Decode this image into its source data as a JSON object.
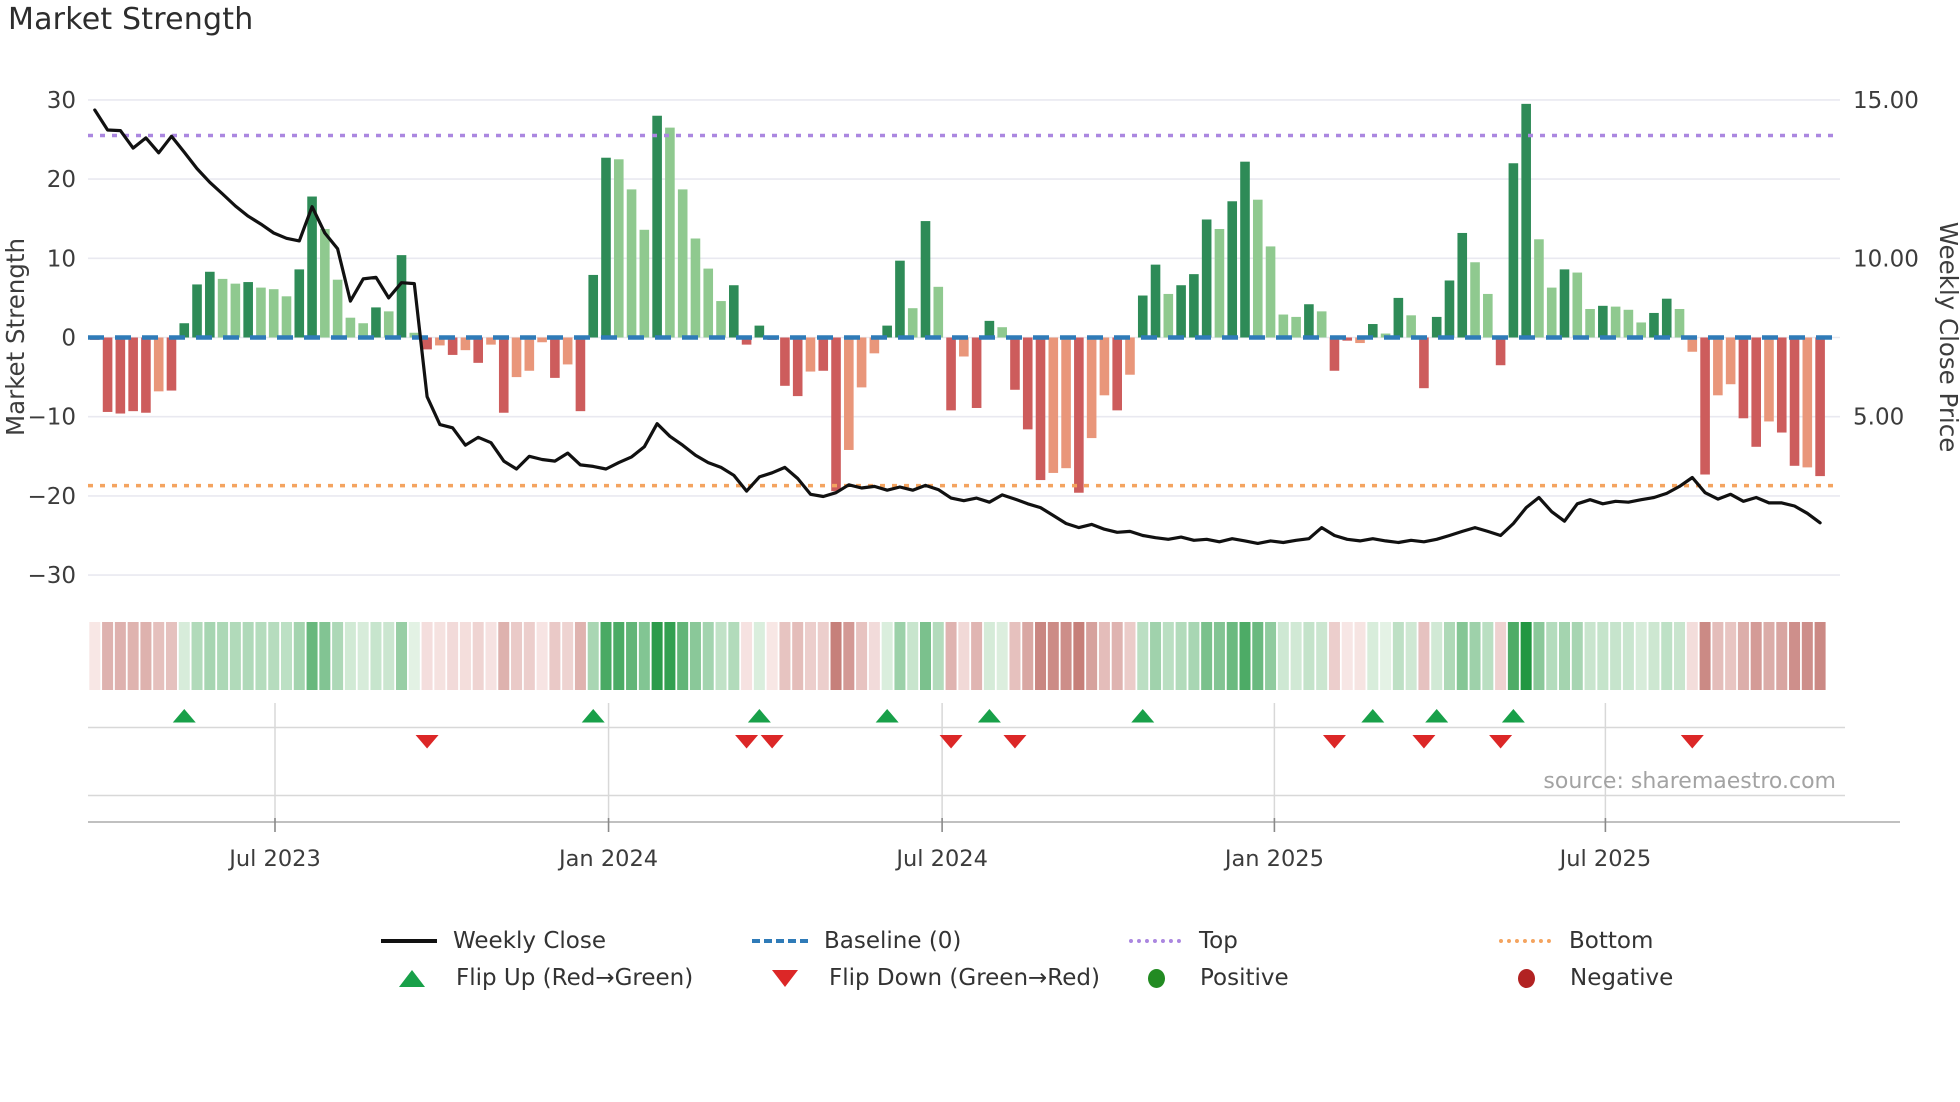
{
  "title": "Market Strength",
  "source_text": "source: sharemaestro.com",
  "axes": {
    "left_label": "Market Strength",
    "right_label": "Weekly Close Price",
    "left_ticks": [
      30,
      20,
      10,
      0,
      -10,
      -20,
      -30
    ],
    "right_ticks": [
      {
        "label": "15.00",
        "at_strength": 30
      },
      {
        "label": "10.00",
        "at_strength": 10
      },
      {
        "label": "5.00",
        "at_strength": -10
      }
    ],
    "x_ticks": [
      {
        "week": 14.1,
        "label": "Jul 2023"
      },
      {
        "week": 40.2,
        "label": "Jan 2024"
      },
      {
        "week": 66.3,
        "label": "Jul 2024"
      },
      {
        "week": 92.3,
        "label": "Jan 2025"
      },
      {
        "week": 118.2,
        "label": "Jul 2025"
      }
    ]
  },
  "legend": {
    "row1": [
      {
        "label": "Weekly Close"
      },
      {
        "label": "Baseline (0)"
      },
      {
        "label": "Top"
      },
      {
        "label": "Bottom"
      }
    ],
    "row2": [
      {
        "label": "Flip Up (Red→Green)"
      },
      {
        "label": "Flip Down (Green→Red)"
      },
      {
        "label": "Positive"
      },
      {
        "label": "Negative"
      }
    ]
  },
  "colors": {
    "bar_pos_strong": "#2e8b57",
    "bar_pos_light": "#8fc98f",
    "bar_neg_strong": "#cd5c5c",
    "bar_neg_light": "#e9967a",
    "line": "#111111",
    "baseline": "#2f7bb8",
    "top_line": "#ab87e0",
    "bottom_line": "#f4a460",
    "flip_up": "#18a049",
    "flip_down": "#dc2727",
    "positive_dot": "#228b22",
    "negative_dot": "#b22222",
    "grid": "#e9e9f0",
    "sub_grid": "#d8d8d8",
    "axis_line": "#c0c0c0",
    "tick_text": "#3c3c3c",
    "source_text": "#a3a3a3",
    "heat_pos_max": "#1f9640",
    "heat_pos_min": "#eaf5ea",
    "heat_neg_max": "#c0736d",
    "heat_neg_min": "#f9e9e8"
  },
  "chart_data": {
    "type": "bar",
    "title": "Market Strength",
    "weeks": 136,
    "ylim_left": [
      -32,
      31.5
    ],
    "grid": "horizontal",
    "legend_position": "bottom-center",
    "top_line_value": 25.5,
    "baseline_value": 0,
    "bottom_line_value": -18.7,
    "strength": {
      "name": "Market Strength",
      "values": [
        -0.3,
        -9.4,
        -9.6,
        -9.3,
        -9.5,
        -6.8,
        -6.7,
        1.8,
        6.7,
        8.3,
        7.4,
        6.8,
        7.0,
        6.3,
        6.1,
        5.2,
        8.6,
        17.8,
        13.7,
        7.3,
        2.5,
        1.8,
        3.8,
        3.3,
        10.4,
        0.6,
        -1.5,
        -1.0,
        -2.2,
        -1.6,
        -3.2,
        -0.9,
        -9.5,
        -5.0,
        -4.2,
        -0.6,
        -5.1,
        -3.4,
        -9.3,
        7.9,
        22.7,
        22.5,
        18.7,
        13.6,
        28.0,
        26.5,
        18.7,
        12.5,
        8.7,
        4.6,
        6.6,
        -0.9,
        1.5,
        -0.3,
        -6.1,
        -7.4,
        -4.3,
        -4.2,
        -19.4,
        -14.2,
        -6.3,
        -2.0,
        1.5,
        9.7,
        3.7,
        14.7,
        6.4,
        -9.2,
        -2.4,
        -8.9,
        2.1,
        1.3,
        -6.6,
        -11.6,
        -18.0,
        -17.1,
        -16.5,
        -19.6,
        -12.7,
        -7.3,
        -9.2,
        -4.7,
        5.3,
        9.2,
        5.5,
        6.6,
        8.0,
        14.9,
        13.7,
        17.2,
        22.2,
        17.4,
        11.5,
        2.9,
        2.6,
        4.2,
        3.3,
        -4.2,
        -0.4,
        -0.7,
        1.7,
        0.5,
        5.0,
        2.8,
        -6.4,
        2.6,
        7.2,
        13.2,
        9.5,
        5.5,
        -3.5,
        22.0,
        29.5,
        12.4,
        6.3,
        8.6,
        8.2,
        3.6,
        4.0,
        3.9,
        3.5,
        1.9,
        3.1,
        4.9,
        3.6,
        -1.8,
        -17.3,
        -7.3,
        -5.9,
        -10.2,
        -13.8,
        -10.6,
        -12.0,
        -16.2,
        -16.4,
        -17.5
      ],
      "shades": "RRRRRrRGGGggGgggGGggggGgGgRrRrRrRrrrRrRGGgggGgggggGRGRRRrRRrrrGGgGgRrRGgRRRrrRrrRrGGgGGGgGGggggGgRRrGgGgRGGGggRGGggGggGgggGGgrRrrRRrRRrR"
    },
    "weekly_close": {
      "name": "Weekly Close",
      "axis": "right",
      "values": [
        14.68,
        14.05,
        14.03,
        13.48,
        13.8,
        13.33,
        13.85,
        13.35,
        12.83,
        12.4,
        12.03,
        11.65,
        11.33,
        11.08,
        10.8,
        10.63,
        10.55,
        11.63,
        10.8,
        10.3,
        8.65,
        9.35,
        9.4,
        8.75,
        9.23,
        9.2,
        5.63,
        4.75,
        4.65,
        4.1,
        4.35,
        4.18,
        3.6,
        3.35,
        3.75,
        3.65,
        3.6,
        3.85,
        3.48,
        3.43,
        3.35,
        3.55,
        3.73,
        4.05,
        4.78,
        4.38,
        4.1,
        3.78,
        3.55,
        3.4,
        3.15,
        2.65,
        3.1,
        3.23,
        3.4,
        3.05,
        2.55,
        2.48,
        2.6,
        2.85,
        2.75,
        2.8,
        2.68,
        2.78,
        2.68,
        2.83,
        2.7,
        2.43,
        2.35,
        2.43,
        2.3,
        2.53,
        2.4,
        2.25,
        2.13,
        1.88,
        1.63,
        1.5,
        1.6,
        1.45,
        1.35,
        1.38,
        1.25,
        1.18,
        1.13,
        1.2,
        1.1,
        1.13,
        1.05,
        1.15,
        1.08,
        1.0,
        1.08,
        1.03,
        1.1,
        1.15,
        1.5,
        1.25,
        1.13,
        1.08,
        1.15,
        1.08,
        1.03,
        1.1,
        1.05,
        1.13,
        1.25,
        1.38,
        1.5,
        1.38,
        1.25,
        1.63,
        2.13,
        2.45,
        2.0,
        1.7,
        2.25,
        2.38,
        2.25,
        2.33,
        2.3,
        2.38,
        2.45,
        2.58,
        2.8,
        3.08,
        2.6,
        2.4,
        2.55,
        2.33,
        2.45,
        2.28,
        2.28,
        2.18,
        1.95,
        1.65
      ]
    },
    "flip_up_weeks": [
      7,
      39,
      52,
      62,
      70,
      82,
      100,
      105,
      111
    ],
    "flip_down_weeks": [
      26,
      51,
      53,
      67,
      72,
      97,
      104,
      110,
      125
    ],
    "heatmap": "one cell per week, color derived from strength value (green positive, red negative)"
  }
}
